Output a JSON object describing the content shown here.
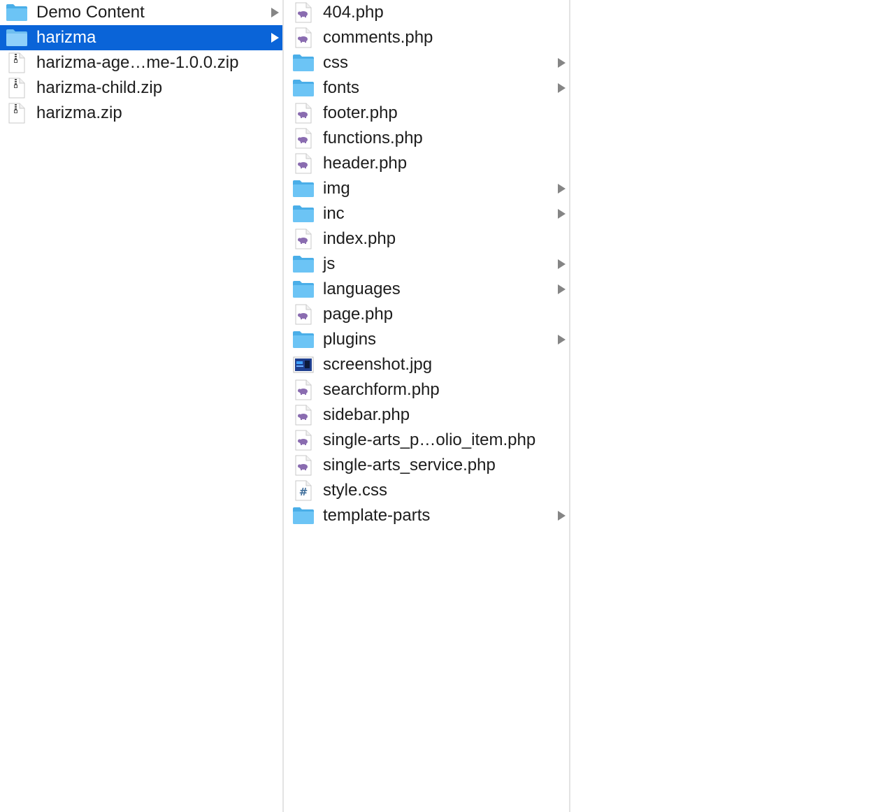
{
  "window": {
    "columns": [
      {
        "items": [
          {
            "label": "Demo Content",
            "type": "folder",
            "icon": "folder-icon",
            "has_children": true,
            "selected": false
          },
          {
            "label": "harizma",
            "type": "folder",
            "icon": "folder-icon",
            "has_children": true,
            "selected": true
          },
          {
            "label": "harizma-age…me-1.0.0.zip",
            "type": "zip",
            "icon": "zip-file-icon",
            "has_children": false,
            "selected": false
          },
          {
            "label": "harizma-child.zip",
            "type": "zip",
            "icon": "zip-file-icon",
            "has_children": false,
            "selected": false
          },
          {
            "label": "harizma.zip",
            "type": "zip",
            "icon": "zip-file-icon",
            "has_children": false,
            "selected": false
          }
        ]
      },
      {
        "items": [
          {
            "label": "404.php",
            "type": "php",
            "icon": "php-file-icon",
            "has_children": false
          },
          {
            "label": "comments.php",
            "type": "php",
            "icon": "php-file-icon",
            "has_children": false
          },
          {
            "label": "css",
            "type": "folder",
            "icon": "folder-icon",
            "has_children": true
          },
          {
            "label": "fonts",
            "type": "folder",
            "icon": "folder-icon",
            "has_children": true
          },
          {
            "label": "footer.php",
            "type": "php",
            "icon": "php-file-icon",
            "has_children": false
          },
          {
            "label": "functions.php",
            "type": "php",
            "icon": "php-file-icon",
            "has_children": false
          },
          {
            "label": "header.php",
            "type": "php",
            "icon": "php-file-icon",
            "has_children": false
          },
          {
            "label": "img",
            "type": "folder",
            "icon": "folder-icon",
            "has_children": true
          },
          {
            "label": "inc",
            "type": "folder",
            "icon": "folder-icon",
            "has_children": true
          },
          {
            "label": "index.php",
            "type": "php",
            "icon": "php-file-icon",
            "has_children": false
          },
          {
            "label": "js",
            "type": "folder",
            "icon": "folder-icon",
            "has_children": true
          },
          {
            "label": "languages",
            "type": "folder",
            "icon": "folder-icon",
            "has_children": true
          },
          {
            "label": "page.php",
            "type": "php",
            "icon": "php-file-icon",
            "has_children": false
          },
          {
            "label": "plugins",
            "type": "folder",
            "icon": "folder-icon",
            "has_children": true
          },
          {
            "label": "screenshot.jpg",
            "type": "image",
            "icon": "image-file-icon",
            "has_children": false
          },
          {
            "label": "searchform.php",
            "type": "php",
            "icon": "php-file-icon",
            "has_children": false
          },
          {
            "label": "sidebar.php",
            "type": "php",
            "icon": "php-file-icon",
            "has_children": false
          },
          {
            "label": "single-arts_p…olio_item.php",
            "type": "php",
            "icon": "php-file-icon",
            "has_children": false
          },
          {
            "label": "single-arts_service.php",
            "type": "php",
            "icon": "php-file-icon",
            "has_children": false
          },
          {
            "label": "style.css",
            "type": "css",
            "icon": "css-file-icon",
            "has_children": false
          },
          {
            "label": "template-parts",
            "type": "folder",
            "icon": "folder-icon",
            "has_children": true
          }
        ]
      },
      {
        "items": []
      }
    ]
  },
  "colors": {
    "selection": "#0a64d8",
    "folder": "#6cc4f5",
    "folder_tab": "#4aaee8",
    "php_elephant": "#8a6cb0",
    "css_hash": "#3f6e9b",
    "arrow": "#858585",
    "divider": "#e3e3e3"
  }
}
